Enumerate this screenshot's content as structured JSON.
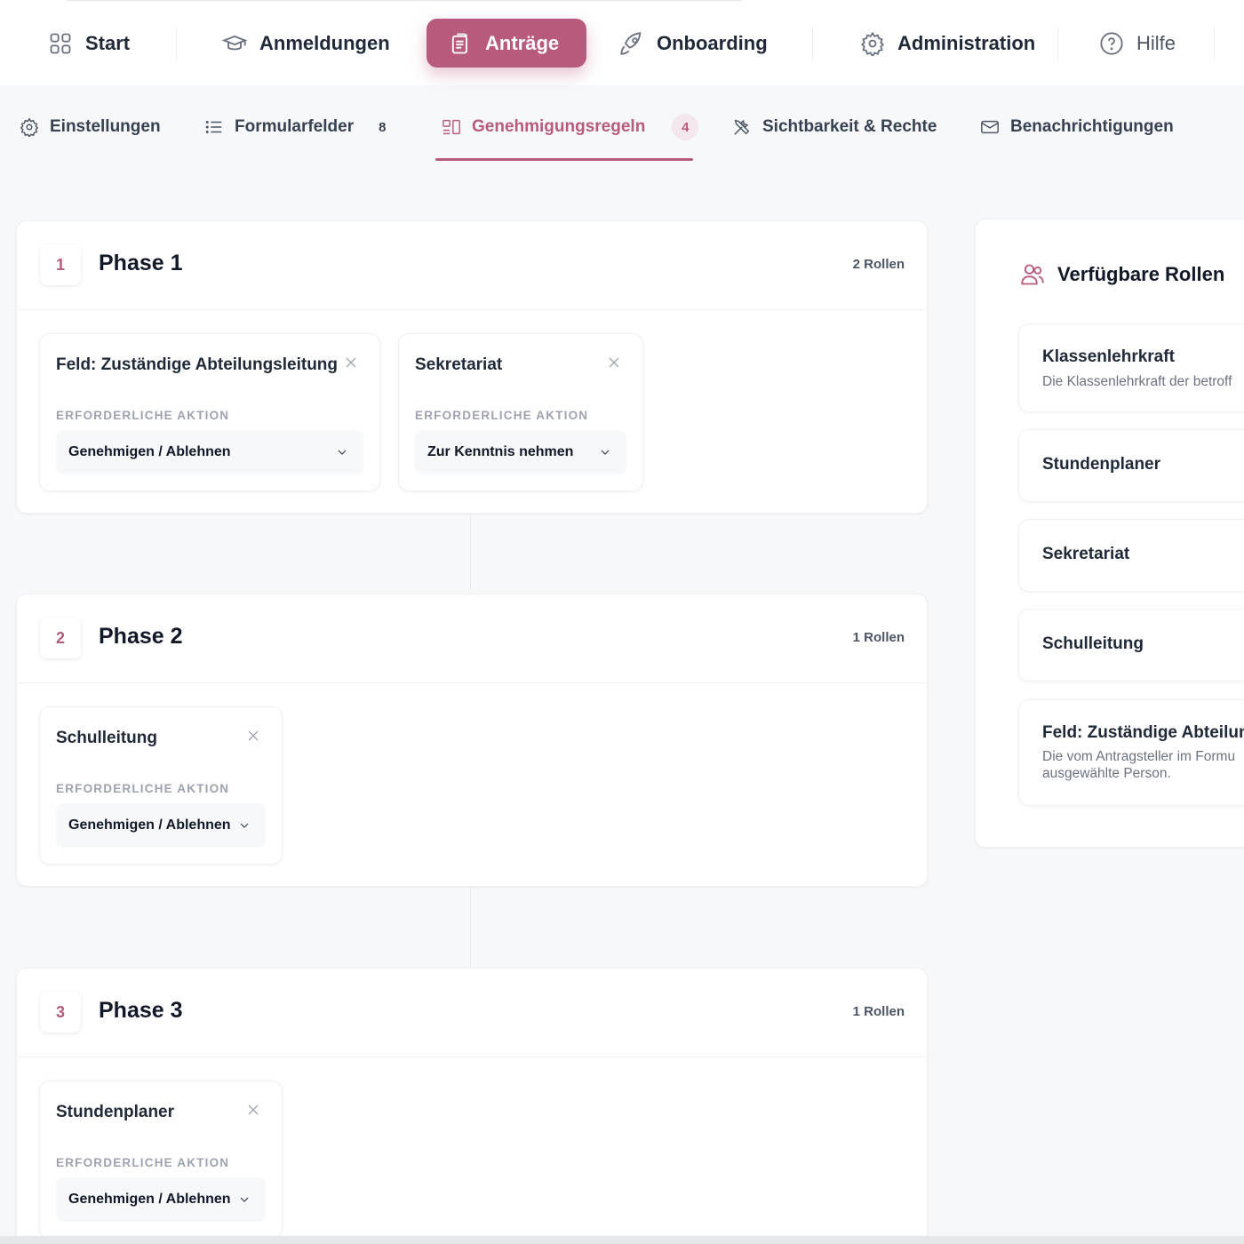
{
  "topnav": {
    "items": [
      {
        "label": "Start",
        "icon": "grid-icon"
      },
      {
        "label": "Anmeldungen",
        "icon": "graduation-cap-icon"
      },
      {
        "label": "Anträge",
        "icon": "clipboard-icon",
        "active": true
      },
      {
        "label": "Onboarding",
        "icon": "rocket-icon"
      },
      {
        "label": "Administration",
        "icon": "gear-icon"
      },
      {
        "label": "Hilfe",
        "icon": "help-circle-icon"
      }
    ]
  },
  "subtabs": {
    "items": [
      {
        "label": "Einstellungen",
        "icon": "gear-icon",
        "count": ""
      },
      {
        "label": "Formularfelder",
        "icon": "list-icon",
        "count": "8"
      },
      {
        "label": "Genehmigungsregeln",
        "icon": "workflow-icon",
        "count": "4",
        "active": true
      },
      {
        "label": "Sichtbarkeit & Rechte",
        "icon": "tools-icon",
        "count": ""
      },
      {
        "label": "Benachrichtigungen",
        "icon": "mail-icon",
        "count": ""
      }
    ]
  },
  "phases": [
    {
      "number": "1",
      "title": "Phase 1",
      "roles_count": "2 Rollen",
      "roles": [
        {
          "name": "Feld: Zuständige Abteilungsleitung",
          "action_label": "ERFORDERLICHE AKTION",
          "action": "Genehmigen / Ablehnen"
        },
        {
          "name": "Sekretariat",
          "action_label": "ERFORDERLICHE AKTION",
          "action": "Zur Kenntnis nehmen"
        }
      ]
    },
    {
      "number": "2",
      "title": "Phase 2",
      "roles_count": "1 Rollen",
      "roles": [
        {
          "name": "Schulleitung",
          "action_label": "ERFORDERLICHE AKTION",
          "action": "Genehmigen / Ablehnen"
        }
      ]
    },
    {
      "number": "3",
      "title": "Phase 3",
      "roles_count": "1 Rollen",
      "roles": [
        {
          "name": "Stundenplaner",
          "action_label": "ERFORDERLICHE AKTION",
          "action": "Genehmigen / Ablehnen"
        }
      ]
    }
  ],
  "available_roles": {
    "title": "Verfügbare Rollen",
    "icon": "users-icon",
    "items": [
      {
        "name": "Klassenlehrkraft",
        "description": "Die Klassenlehrkraft der betroff"
      },
      {
        "name": "Stundenplaner",
        "description": ""
      },
      {
        "name": "Sekretariat",
        "description": ""
      },
      {
        "name": "Schulleitung",
        "description": ""
      },
      {
        "name": "Feld: Zuständige Abteilun",
        "description_line1": "Die vom Antragsteller im Formu",
        "description_line2": "ausgewählte Person."
      }
    ]
  },
  "colors": {
    "accent": "#b75a7d",
    "accent_soft": "#f3e6ec",
    "background": "#f7f8fa",
    "card": "#ffffff",
    "muted_text": "#9ca3af"
  }
}
